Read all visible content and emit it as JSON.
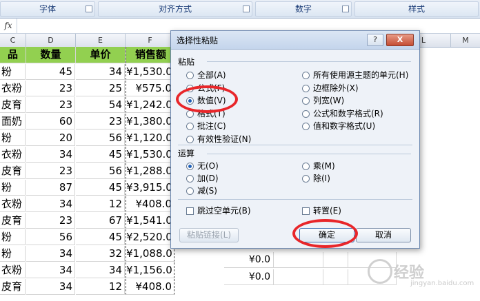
{
  "ribbon": {
    "groups": [
      {
        "label": "字体"
      },
      {
        "label": "对齐方式"
      },
      {
        "label": "数字"
      },
      {
        "label": "样式"
      }
    ]
  },
  "formula_bar": {
    "fx_label": "fx",
    "value": ""
  },
  "columns": [
    "C",
    "D",
    "E",
    "F",
    "L",
    "M"
  ],
  "table": {
    "headers": [
      "品",
      "数量",
      "单价",
      "销售额"
    ],
    "rows": [
      {
        "name": "粉",
        "qty": "45",
        "price": "34",
        "sales": "¥1,530.0"
      },
      {
        "name": "衣粉",
        "qty": "23",
        "price": "25",
        "sales": "¥575.0"
      },
      {
        "name": "皮育",
        "qty": "23",
        "price": "54",
        "sales": "¥1,242.0"
      },
      {
        "name": "面奶",
        "qty": "60",
        "price": "23",
        "sales": "¥1,380.0"
      },
      {
        "name": "粉",
        "qty": "20",
        "price": "56",
        "sales": "¥1,120.0"
      },
      {
        "name": "衣粉",
        "qty": "34",
        "price": "45",
        "sales": "¥1,530.0"
      },
      {
        "name": "皮育",
        "qty": "23",
        "price": "56",
        "sales": "¥1,288.0"
      },
      {
        "name": "粉",
        "qty": "87",
        "price": "45",
        "sales": "¥3,915.0"
      },
      {
        "name": "衣粉",
        "qty": "34",
        "price": "12",
        "sales": "¥408.0"
      },
      {
        "name": "皮育",
        "qty": "23",
        "price": "67",
        "sales": "¥1,541.0"
      },
      {
        "name": "粉",
        "qty": "56",
        "price": "45",
        "sales": "¥2,520.0"
      },
      {
        "name": "粉",
        "qty": "34",
        "price": "32",
        "sales": "¥1,088.0"
      },
      {
        "name": "衣粉",
        "qty": "34",
        "price": "34",
        "sales": "¥1,156.0"
      },
      {
        "name": "皮育",
        "qty": "34",
        "price": "12",
        "sales": "¥408.0"
      }
    ],
    "right_values": [
      "¥0.0",
      "¥0.0"
    ]
  },
  "dialog": {
    "title": "选择性粘贴",
    "help_label": "?",
    "close_label": "X",
    "paste_section": "粘贴",
    "paste_options_left": [
      "全部(A)",
      "公式(F)",
      "数值(V)",
      "格式(T)",
      "批注(C)",
      "有效性验证(N)"
    ],
    "paste_options_right": [
      "所有使用源主题的单元(H)",
      "边框除外(X)",
      "列宽(W)",
      "公式和数字格式(R)",
      "值和数字格式(U)"
    ],
    "paste_selected": "数值(V)",
    "operation_section": "运算",
    "operation_left": [
      "无(O)",
      "加(D)",
      "减(S)"
    ],
    "operation_right": [
      "乘(M)",
      "除(I)"
    ],
    "operation_selected": "无(O)",
    "skip_blanks": "跳过空单元(B)",
    "transpose": "转置(E)",
    "paste_link": "粘贴链接(L)",
    "ok": "确定",
    "cancel": "取消"
  },
  "watermark": {
    "text": "经验",
    "sub": "jingyan.baidu.com"
  },
  "colors": {
    "header_green": "#92d050",
    "highlight_red": "#e8262a"
  },
  "icons": [
    "dialog-launcher-icon",
    "help-icon",
    "close-icon"
  ]
}
